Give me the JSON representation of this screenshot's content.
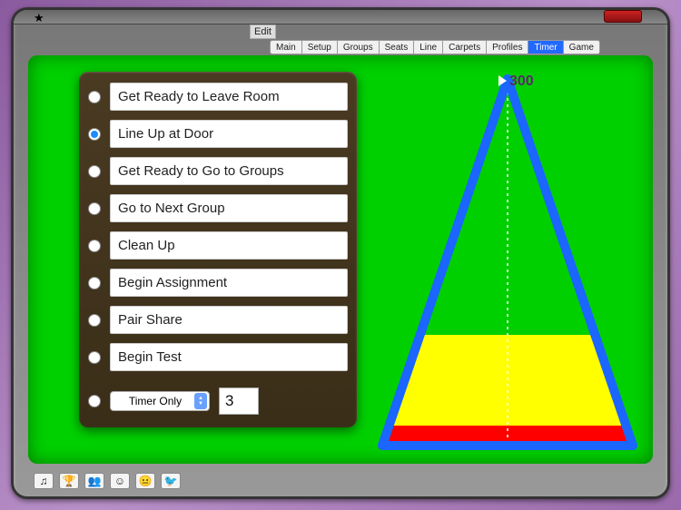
{
  "header": {
    "edit_label": "Edit",
    "tabs": [
      "Main",
      "Setup",
      "Groups",
      "Seats",
      "Line",
      "Carpets",
      "Profiles",
      "Timer",
      "Game"
    ],
    "active_tab": "Timer"
  },
  "timer_value": "300",
  "options": [
    {
      "label": "Get Ready to Leave Room",
      "selected": false
    },
    {
      "label": "Line Up at Door",
      "selected": true
    },
    {
      "label": "Get Ready to Go to Groups",
      "selected": false
    },
    {
      "label": "Go to Next Group",
      "selected": false
    },
    {
      "label": "Clean Up",
      "selected": false
    },
    {
      "label": "Begin Assignment",
      "selected": false
    },
    {
      "label": "Pair Share",
      "selected": false
    },
    {
      "label": "Begin Test",
      "selected": false
    }
  ],
  "mode_select": {
    "label": "Timer Only"
  },
  "number_value": "3",
  "bottom_icons": {
    "music": "♫",
    "trophy": "🏆",
    "group": "👥",
    "smile": "☺",
    "neutral": "😐",
    "bird": "🐦"
  },
  "triangle": {
    "green_h": 290,
    "yellow_h": 100,
    "red_h": 22
  }
}
